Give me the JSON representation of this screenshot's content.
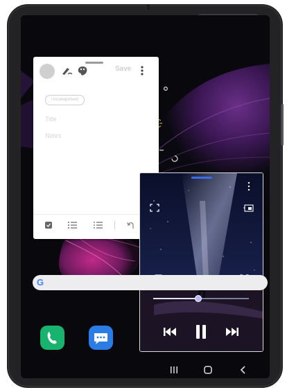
{
  "notes_window": {
    "toolbar": {
      "save_label": "Save",
      "icons": [
        "avatar",
        "pen-icon",
        "palette-icon",
        "kebab-menu-icon"
      ]
    },
    "category_chip": "Uncategorised",
    "title_placeholder": "Title",
    "notes_placeholder": "Notes",
    "bottom_toolbar_icons": [
      "checkbox-icon",
      "bullet-list-icon",
      "numbered-list-icon",
      "undo-icon"
    ]
  },
  "video_window": {
    "controls": [
      "drag-handle",
      "kebab-menu-icon",
      "fullscreen-icon",
      "pip-icon",
      "popup-view-icon",
      "expand-icon",
      "previous-icon",
      "pause-icon",
      "next-icon"
    ],
    "playback_progress": 0.47
  },
  "home_screen": {
    "search_logo": "G",
    "dock_apps": [
      "phone-icon",
      "messages-icon"
    ]
  },
  "navigation_bar": [
    "recent-apps-button",
    "home-button",
    "back-button"
  ],
  "colors": {
    "device_body": "#232326",
    "wallpaper_purple": "#5c2d7a",
    "phone_app": "#18b36f",
    "messages_app": "#2b7ce5",
    "seek_thumb": "#b8b8ff",
    "google_blue": "#4285f4"
  }
}
